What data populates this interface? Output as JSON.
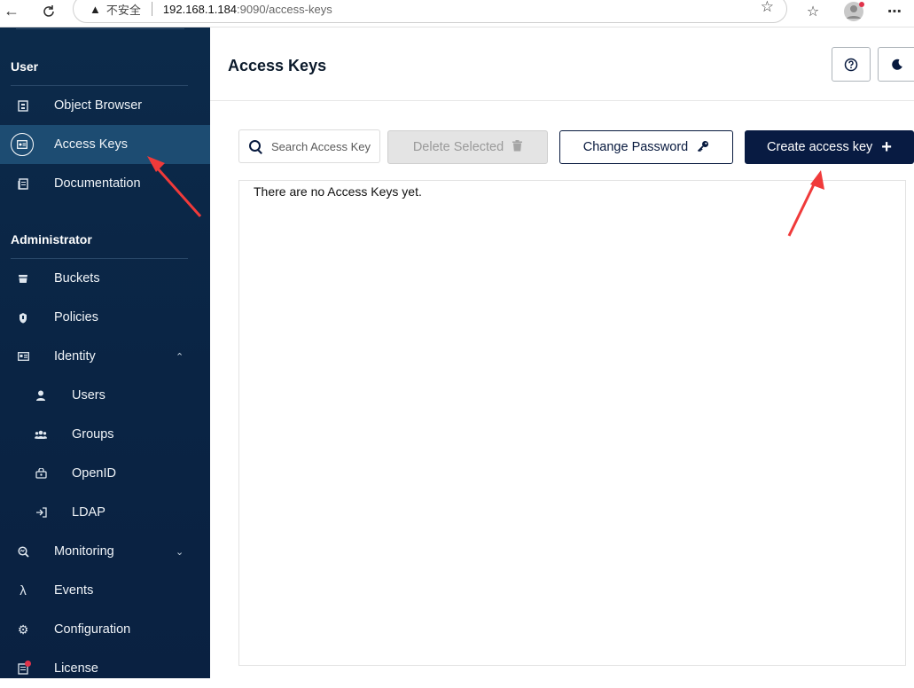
{
  "browser": {
    "security_label": "不安全",
    "url_host": "192.168.1.184",
    "url_rest": ":9090/access-keys"
  },
  "sidebar": {
    "user_section": "User",
    "admin_section": "Administrator",
    "user_items": [
      {
        "label": "Object Browser",
        "icon": "object-browser-icon"
      },
      {
        "label": "Access Keys",
        "icon": "access-keys-icon",
        "active": true
      },
      {
        "label": "Documentation",
        "icon": "documentation-icon"
      }
    ],
    "admin_items": [
      {
        "label": "Buckets",
        "icon": "bucket-icon"
      },
      {
        "label": "Policies",
        "icon": "policy-icon"
      },
      {
        "label": "Identity",
        "icon": "identity-icon",
        "expanded": true
      },
      {
        "label": "Users",
        "icon": "user-icon"
      },
      {
        "label": "Groups",
        "icon": "groups-icon"
      },
      {
        "label": "OpenID",
        "icon": "openid-icon"
      },
      {
        "label": "LDAP",
        "icon": "ldap-icon"
      },
      {
        "label": "Monitoring",
        "icon": "monitoring-icon"
      },
      {
        "label": "Events",
        "icon": "lambda-icon"
      },
      {
        "label": "Configuration",
        "icon": "gear-icon"
      },
      {
        "label": "License",
        "icon": "license-icon"
      }
    ]
  },
  "header": {
    "title": "Access Keys"
  },
  "toolbar": {
    "search_placeholder": "Search Access Keys",
    "delete_label": "Delete Selected",
    "change_password_label": "Change Password",
    "create_label": "Create access key"
  },
  "content": {
    "empty_message": "There are no Access Keys yet."
  },
  "colors": {
    "sidebar_bg": "#0c2a4a",
    "active_item_bg": "#1d4c72",
    "primary": "#081b42",
    "annotation_arrow": "#f03a3a"
  }
}
